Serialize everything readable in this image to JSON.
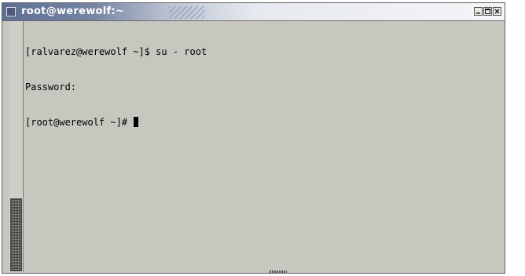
{
  "window": {
    "title": "root@werewolf:~"
  },
  "terminal": {
    "lines": [
      "[ralvarez@werewolf ~]$ su - root",
      "Password:"
    ],
    "prompt": "[root@werewolf ~]# "
  },
  "icons": {
    "system_menu": "system-menu-icon",
    "minimize": "minimize-icon",
    "maximize": "maximize-icon",
    "close": "close-icon"
  }
}
